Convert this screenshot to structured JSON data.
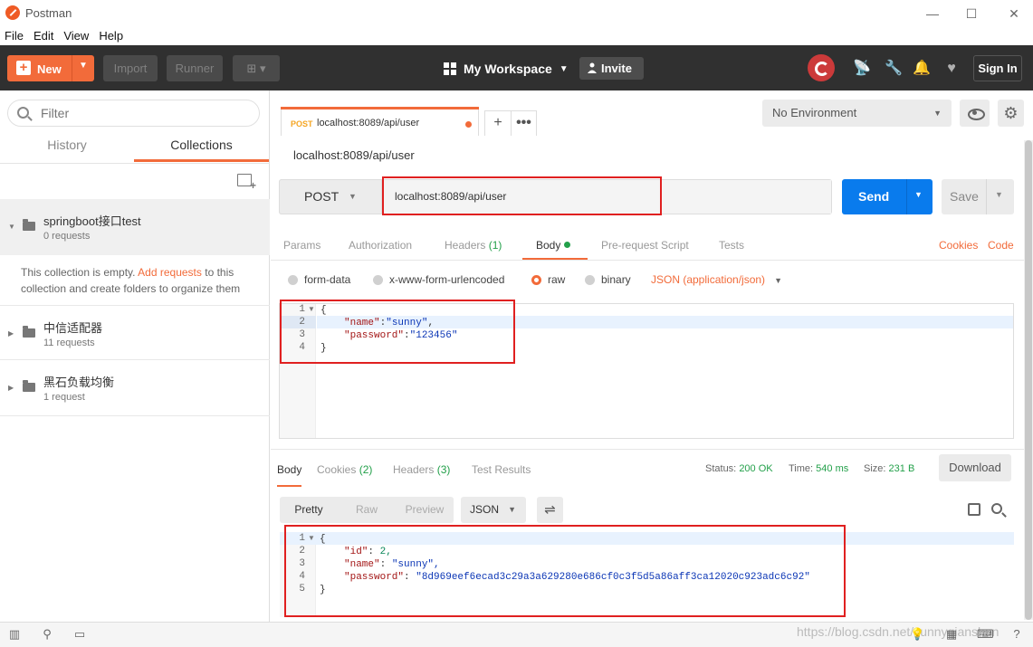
{
  "window": {
    "title": "Postman"
  },
  "menu": [
    "File",
    "Edit",
    "View",
    "Help"
  ],
  "header": {
    "new_label": "New",
    "import_label": "Import",
    "runner_label": "Runner",
    "workspace_label": "My Workspace",
    "invite_label": "Invite",
    "signin_label": "Sign In"
  },
  "sidebar": {
    "filter_placeholder": "Filter",
    "tabs": [
      "History",
      "Collections"
    ],
    "active_tab": "Collections",
    "collections": [
      {
        "name": "springboot接口test",
        "count": "0 requests",
        "expanded": true
      },
      {
        "name": "中信适配器",
        "count": "11 requests",
        "expanded": false
      },
      {
        "name": "黑石负载均衡",
        "count": "1 request",
        "expanded": false
      }
    ],
    "empty_msg_pre": "This collection is empty.",
    "empty_msg_link": "Add requests",
    "empty_msg_post": "to this collection and create folders to organize them"
  },
  "request_tab": {
    "method": "POST",
    "url": "localhost:8089/api/user"
  },
  "environment": {
    "selected": "No Environment"
  },
  "request": {
    "title": "localhost:8089/api/user",
    "method": "POST",
    "url": "localhost:8089/api/user",
    "send_label": "Send",
    "save_label": "Save",
    "tabs": [
      {
        "label": "Params",
        "count": ""
      },
      {
        "label": "Authorization",
        "count": ""
      },
      {
        "label": "Headers",
        "count": "(1)"
      },
      {
        "label": "Body",
        "count": ""
      },
      {
        "label": "Pre-request Script",
        "count": ""
      },
      {
        "label": "Tests",
        "count": ""
      }
    ],
    "active_tab": "Body",
    "right_links": [
      "Cookies",
      "Code"
    ],
    "body_modes": [
      "form-data",
      "x-www-form-urlencoded",
      "raw",
      "binary"
    ],
    "body_mode_selected": "raw",
    "content_type": "JSON (application/json)",
    "body_lines": [
      "{",
      "    \"name\":\"sunny\",",
      "    \"password\":\"123456\"",
      "}"
    ],
    "body_key_name": "\"name\"",
    "body_val_name": "\"sunny\"",
    "body_key_password": "\"password\"",
    "body_val_password": "\"123456\"",
    "line_numbers": [
      "1",
      "2",
      "3",
      "4"
    ]
  },
  "response": {
    "tabs": [
      {
        "label": "Body",
        "count": ""
      },
      {
        "label": "Cookies",
        "count": "(2)"
      },
      {
        "label": "Headers",
        "count": "(3)"
      },
      {
        "label": "Test Results",
        "count": ""
      }
    ],
    "status_label": "Status:",
    "status_value": "200 OK",
    "time_label": "Time:",
    "time_value": "540 ms",
    "size_label": "Size:",
    "size_value": "231 B",
    "download_label": "Download",
    "formats": [
      "Pretty",
      "Raw",
      "Preview"
    ],
    "active_format": "Pretty",
    "language": "JSON",
    "line_numbers": [
      "1",
      "2",
      "3",
      "4",
      "5"
    ],
    "key_id": "\"id\"",
    "val_id": "2,",
    "key_name": "\"name\"",
    "val_name": "\"sunny\",",
    "key_password": "\"password\"",
    "val_password": "\"8d969eef6ecad3c29a3a629280e686cf0c3f5d5a86aff3ca12020c923adc6c92\"",
    "open_brace": "{",
    "close_brace": "}"
  },
  "watermark": "https://blog.csdn.net/sunnyqianshen",
  "colors": {
    "accent": "#f26b3a",
    "send": "#097bed",
    "success": "#23a04a",
    "header_bg": "#303030"
  }
}
